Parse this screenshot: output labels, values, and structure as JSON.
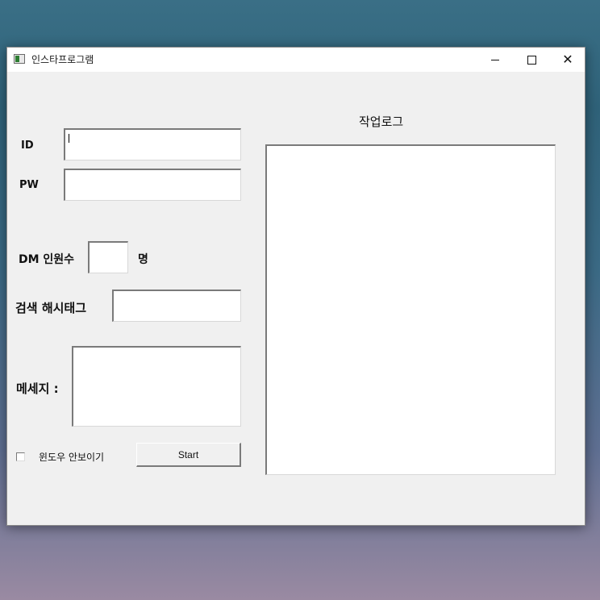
{
  "window": {
    "title": "인스타프로그램",
    "controls": {
      "minimize": "—",
      "maximize": "☐",
      "close": "✕"
    }
  },
  "form": {
    "id_label": "ID",
    "id_value": "",
    "pw_label": "PW",
    "pw_value": "",
    "dm_label": "DM 인원수",
    "dm_value": "",
    "dm_unit": "명",
    "hashtag_label": "검색 해시태그",
    "hashtag_value": "",
    "message_label": "메세지 :",
    "message_value": "",
    "hide_window_label": "윈도우 안보이기",
    "hide_window_checked": false,
    "start_label": "Start"
  },
  "log": {
    "title": "작업로그",
    "content": ""
  },
  "icons": {
    "app": "app-window-icon",
    "minimize": "minimize-icon",
    "maximize": "maximize-icon",
    "close": "close-icon",
    "checkbox": "checkbox-icon"
  }
}
